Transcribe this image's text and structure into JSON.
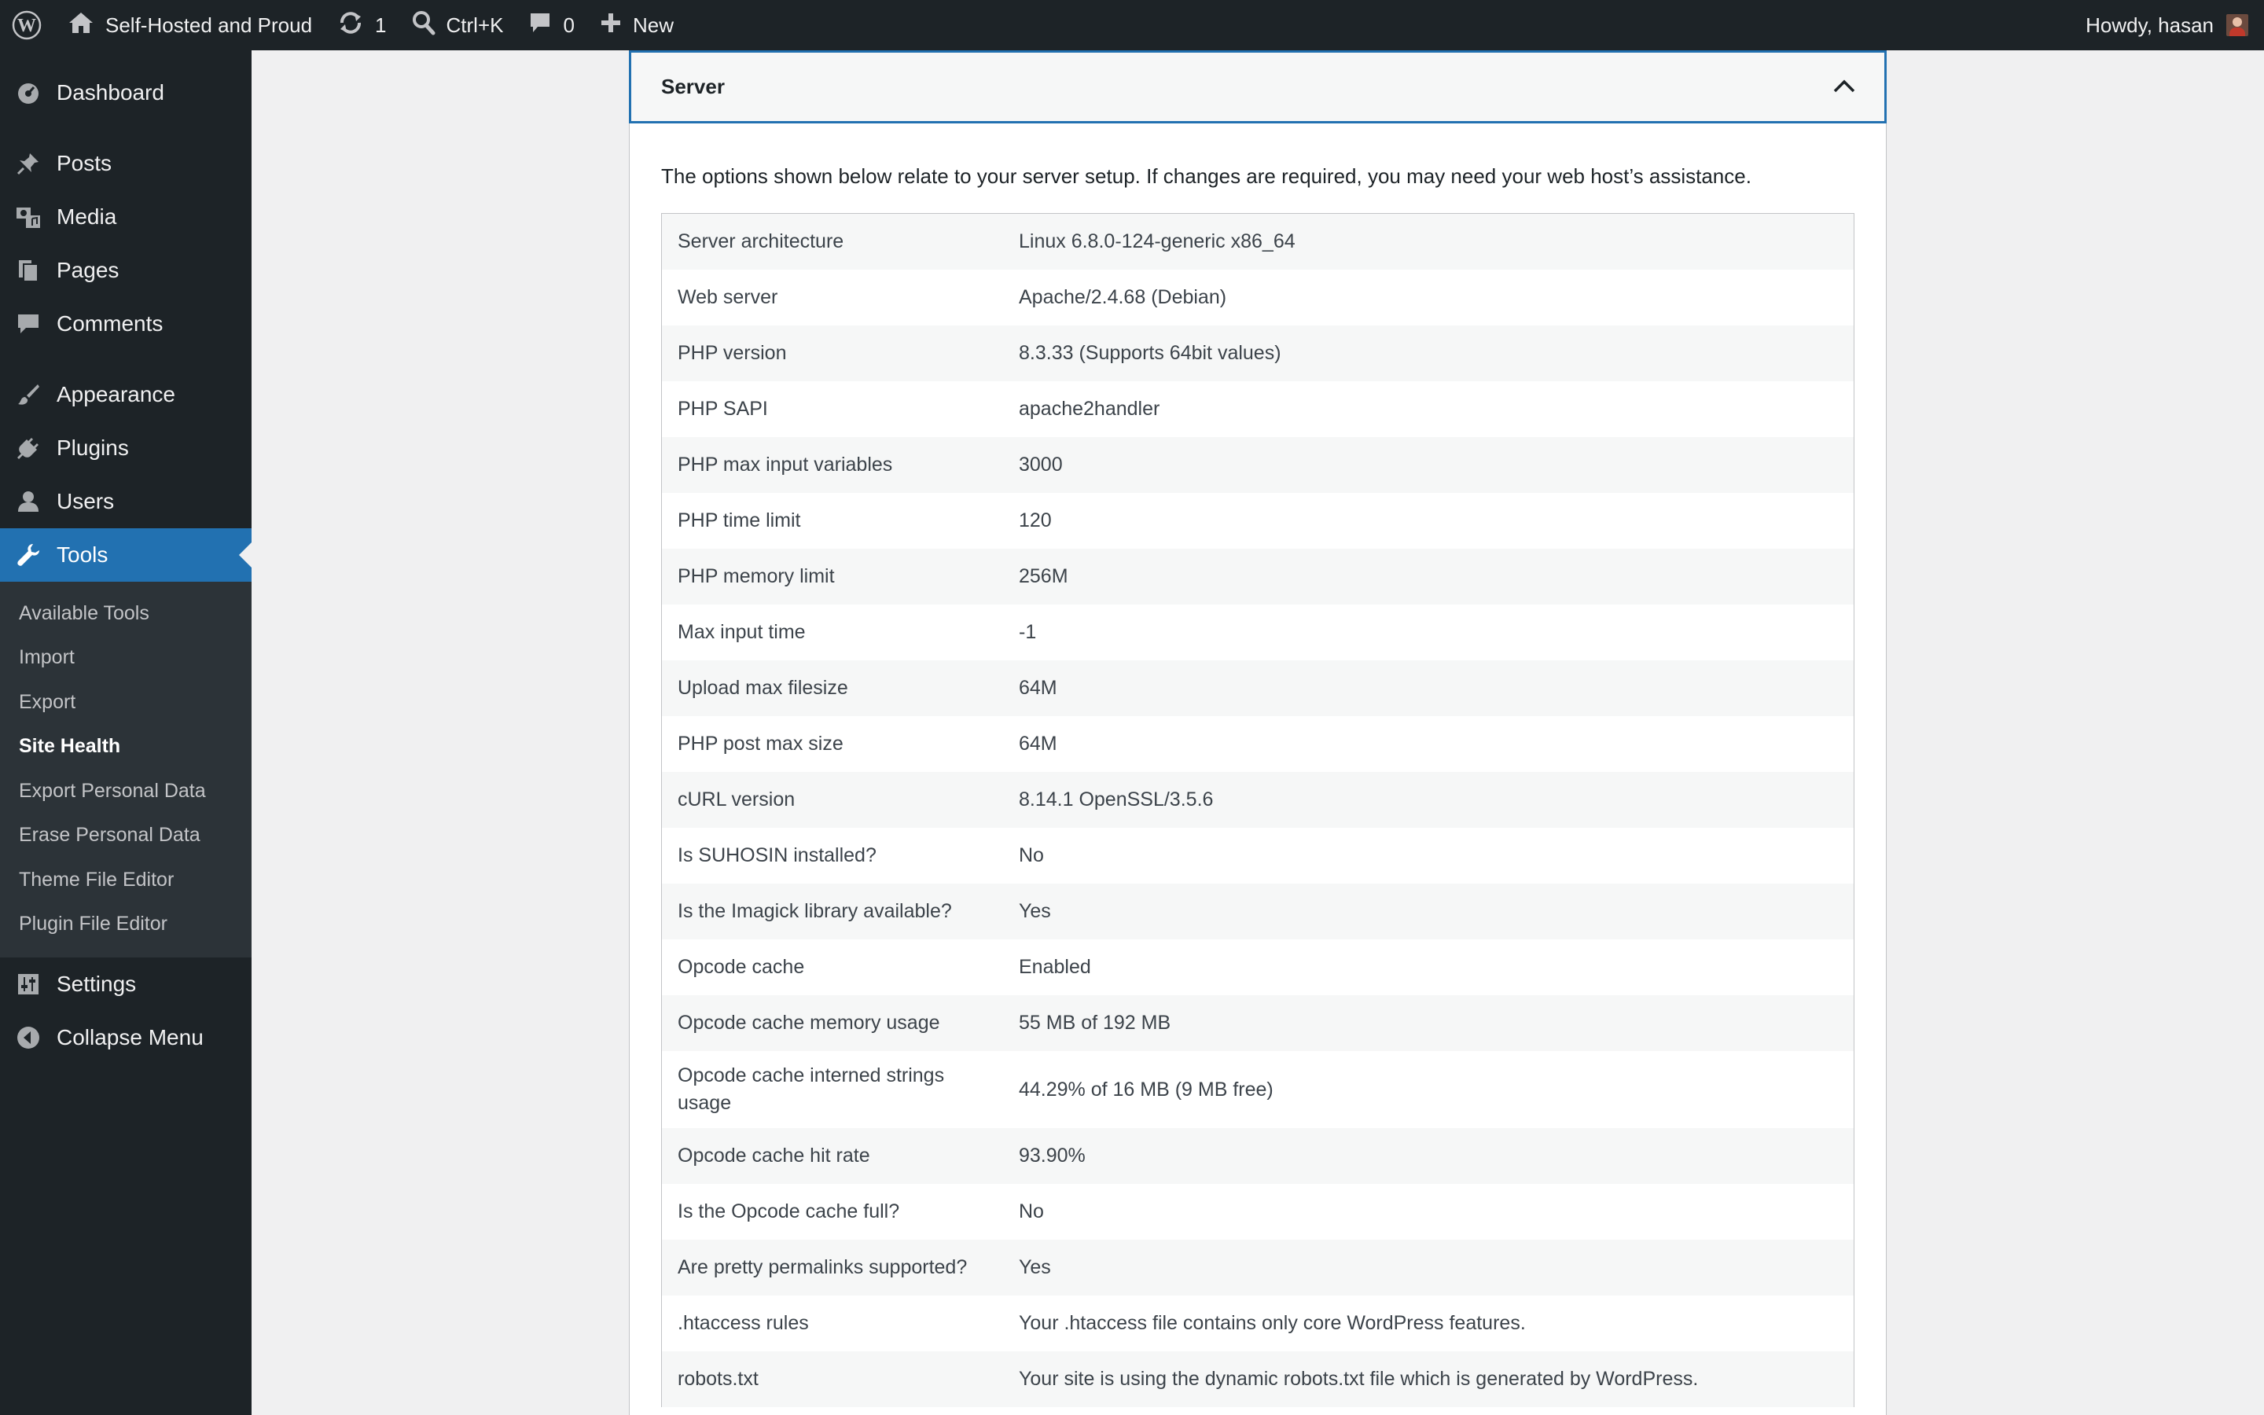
{
  "admin_bar": {
    "site_name": "Self-Hosted and Proud",
    "updates_count": "1",
    "search_shortcut": "Ctrl+K",
    "comments_count": "0",
    "new_label": "New",
    "greeting": "Howdy, hasan"
  },
  "sidebar": {
    "dashboard": "Dashboard",
    "posts": "Posts",
    "media": "Media",
    "pages": "Pages",
    "comments": "Comments",
    "appearance": "Appearance",
    "plugins": "Plugins",
    "users": "Users",
    "tools": "Tools",
    "tools_submenu": [
      "Available Tools",
      "Import",
      "Export",
      "Site Health",
      "Export Personal Data",
      "Erase Personal Data",
      "Theme File Editor",
      "Plugin File Editor"
    ],
    "settings": "Settings",
    "collapse": "Collapse Menu"
  },
  "section": {
    "title": "Server",
    "intro": "The options shown below relate to your server setup. If changes are required, you may need your web host’s assistance."
  },
  "rows": [
    {
      "label": "Server architecture",
      "value": "Linux 6.8.0-124-generic x86_64"
    },
    {
      "label": "Web server",
      "value": "Apache/2.4.68 (Debian)"
    },
    {
      "label": "PHP version",
      "value": "8.3.33 (Supports 64bit values)"
    },
    {
      "label": "PHP SAPI",
      "value": "apache2handler"
    },
    {
      "label": "PHP max input variables",
      "value": "3000"
    },
    {
      "label": "PHP time limit",
      "value": "120"
    },
    {
      "label": "PHP memory limit",
      "value": "256M"
    },
    {
      "label": "Max input time",
      "value": "-1"
    },
    {
      "label": "Upload max filesize",
      "value": "64M"
    },
    {
      "label": "PHP post max size",
      "value": "64M"
    },
    {
      "label": "cURL version",
      "value": "8.14.1 OpenSSL/3.5.6"
    },
    {
      "label": "Is SUHOSIN installed?",
      "value": "No"
    },
    {
      "label": "Is the Imagick library available?",
      "value": "Yes"
    },
    {
      "label": "Opcode cache",
      "value": "Enabled"
    },
    {
      "label": "Opcode cache memory usage",
      "value": "55 MB of 192 MB"
    },
    {
      "label": "Opcode cache interned strings usage",
      "value": "44.29% of 16 MB (9 MB free)"
    },
    {
      "label": "Opcode cache hit rate",
      "value": "93.90%"
    },
    {
      "label": "Is the Opcode cache full?",
      "value": "No"
    },
    {
      "label": "Are pretty permalinks supported?",
      "value": "Yes"
    },
    {
      "label": ".htaccess rules",
      "value": "Your .htaccess file contains only core WordPress features."
    },
    {
      "label": "robots.txt",
      "value": "Your site is using the dynamic robots.txt file which is generated by WordPress."
    }
  ]
}
